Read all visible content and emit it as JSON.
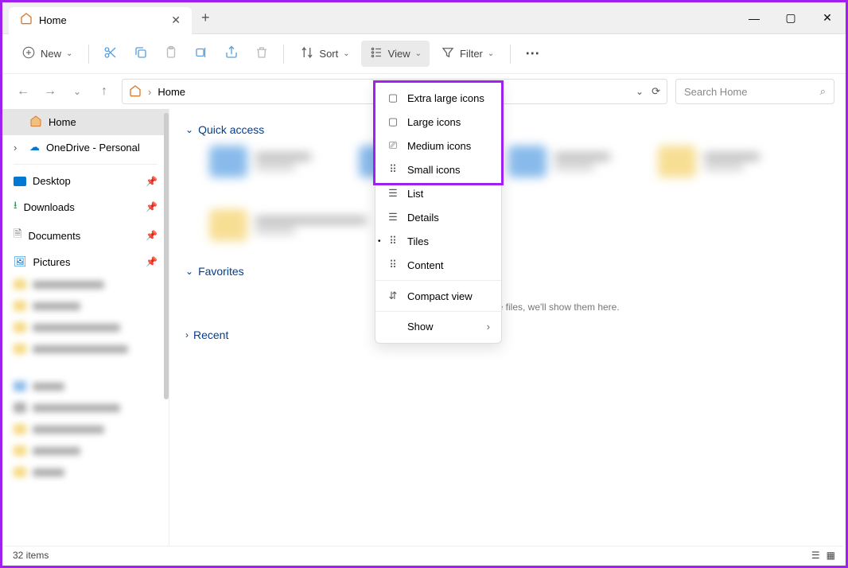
{
  "window": {
    "tab_label": "Home",
    "minimize": "—",
    "maximize": "▢",
    "close": "✕",
    "new_tab": "+",
    "tab_close": "✕"
  },
  "toolbar": {
    "new_label": "New",
    "sort_label": "Sort",
    "view_label": "View",
    "filter_label": "Filter",
    "more": "⋯"
  },
  "breadcrumb": {
    "home": "Home"
  },
  "search": {
    "placeholder": "Search Home"
  },
  "sidebar": {
    "home": "Home",
    "onedrive": "OneDrive - Personal",
    "desktop": "Desktop",
    "downloads": "Downloads",
    "documents": "Documents",
    "pictures": "Pictures"
  },
  "sections": {
    "quick_access": "Quick access",
    "favorites": "Favorites",
    "favorites_msg": "After you've pinned some files, we'll show them here.",
    "recent": "Recent"
  },
  "viewmenu": {
    "xl_icons": "Extra large icons",
    "l_icons": "Large icons",
    "m_icons": "Medium icons",
    "s_icons": "Small icons",
    "list": "List",
    "details": "Details",
    "tiles": "Tiles",
    "content": "Content",
    "compact": "Compact view",
    "show": "Show"
  },
  "status": {
    "count": "32 items"
  }
}
